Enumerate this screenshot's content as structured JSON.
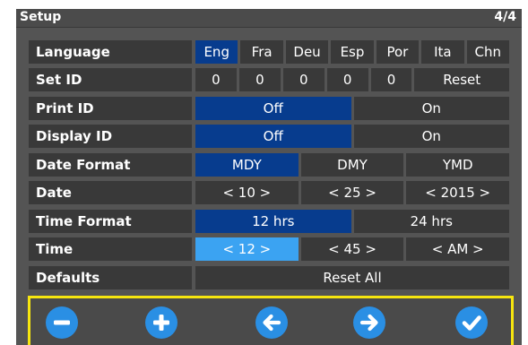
{
  "header": {
    "title": "Setup",
    "page": "4/4"
  },
  "rows": [
    {
      "label": "Language",
      "options": [
        "Eng",
        "Fra",
        "Deu",
        "Esp",
        "Por",
        "Ita",
        "Chn"
      ],
      "selected": 0
    },
    {
      "label": "Set ID",
      "options": [
        "0",
        "0",
        "0",
        "0",
        "0",
        "Reset"
      ]
    },
    {
      "label": "Print ID",
      "options": [
        "Off",
        "On"
      ],
      "selected": 0
    },
    {
      "label": "Display ID",
      "options": [
        "Off",
        "On"
      ],
      "selected": 0
    },
    {
      "label": "Date Format",
      "options": [
        "MDY",
        "DMY",
        "YMD"
      ],
      "selected": 0
    },
    {
      "label": "Date",
      "options": [
        "< 10 >",
        "< 25 >",
        "< 2015 >"
      ]
    },
    {
      "label": "Time Format",
      "options": [
        "12 hrs",
        "24 hrs"
      ],
      "selected": 0
    },
    {
      "label": "Time",
      "options": [
        "< 12 >",
        "< 45 >",
        "< AM >"
      ],
      "focused": 0
    },
    {
      "label": "Defaults",
      "options": [
        "Reset All"
      ]
    }
  ],
  "navbar": {
    "buttons": [
      "minus-icon",
      "plus-icon",
      "arrow-left-icon",
      "arrow-right-icon",
      "checkmark-icon"
    ]
  },
  "colors": {
    "selected": "#073c8e",
    "focused": "#3ba3f2",
    "highlight": "#f7e60f",
    "button": "#2a8fe4"
  }
}
